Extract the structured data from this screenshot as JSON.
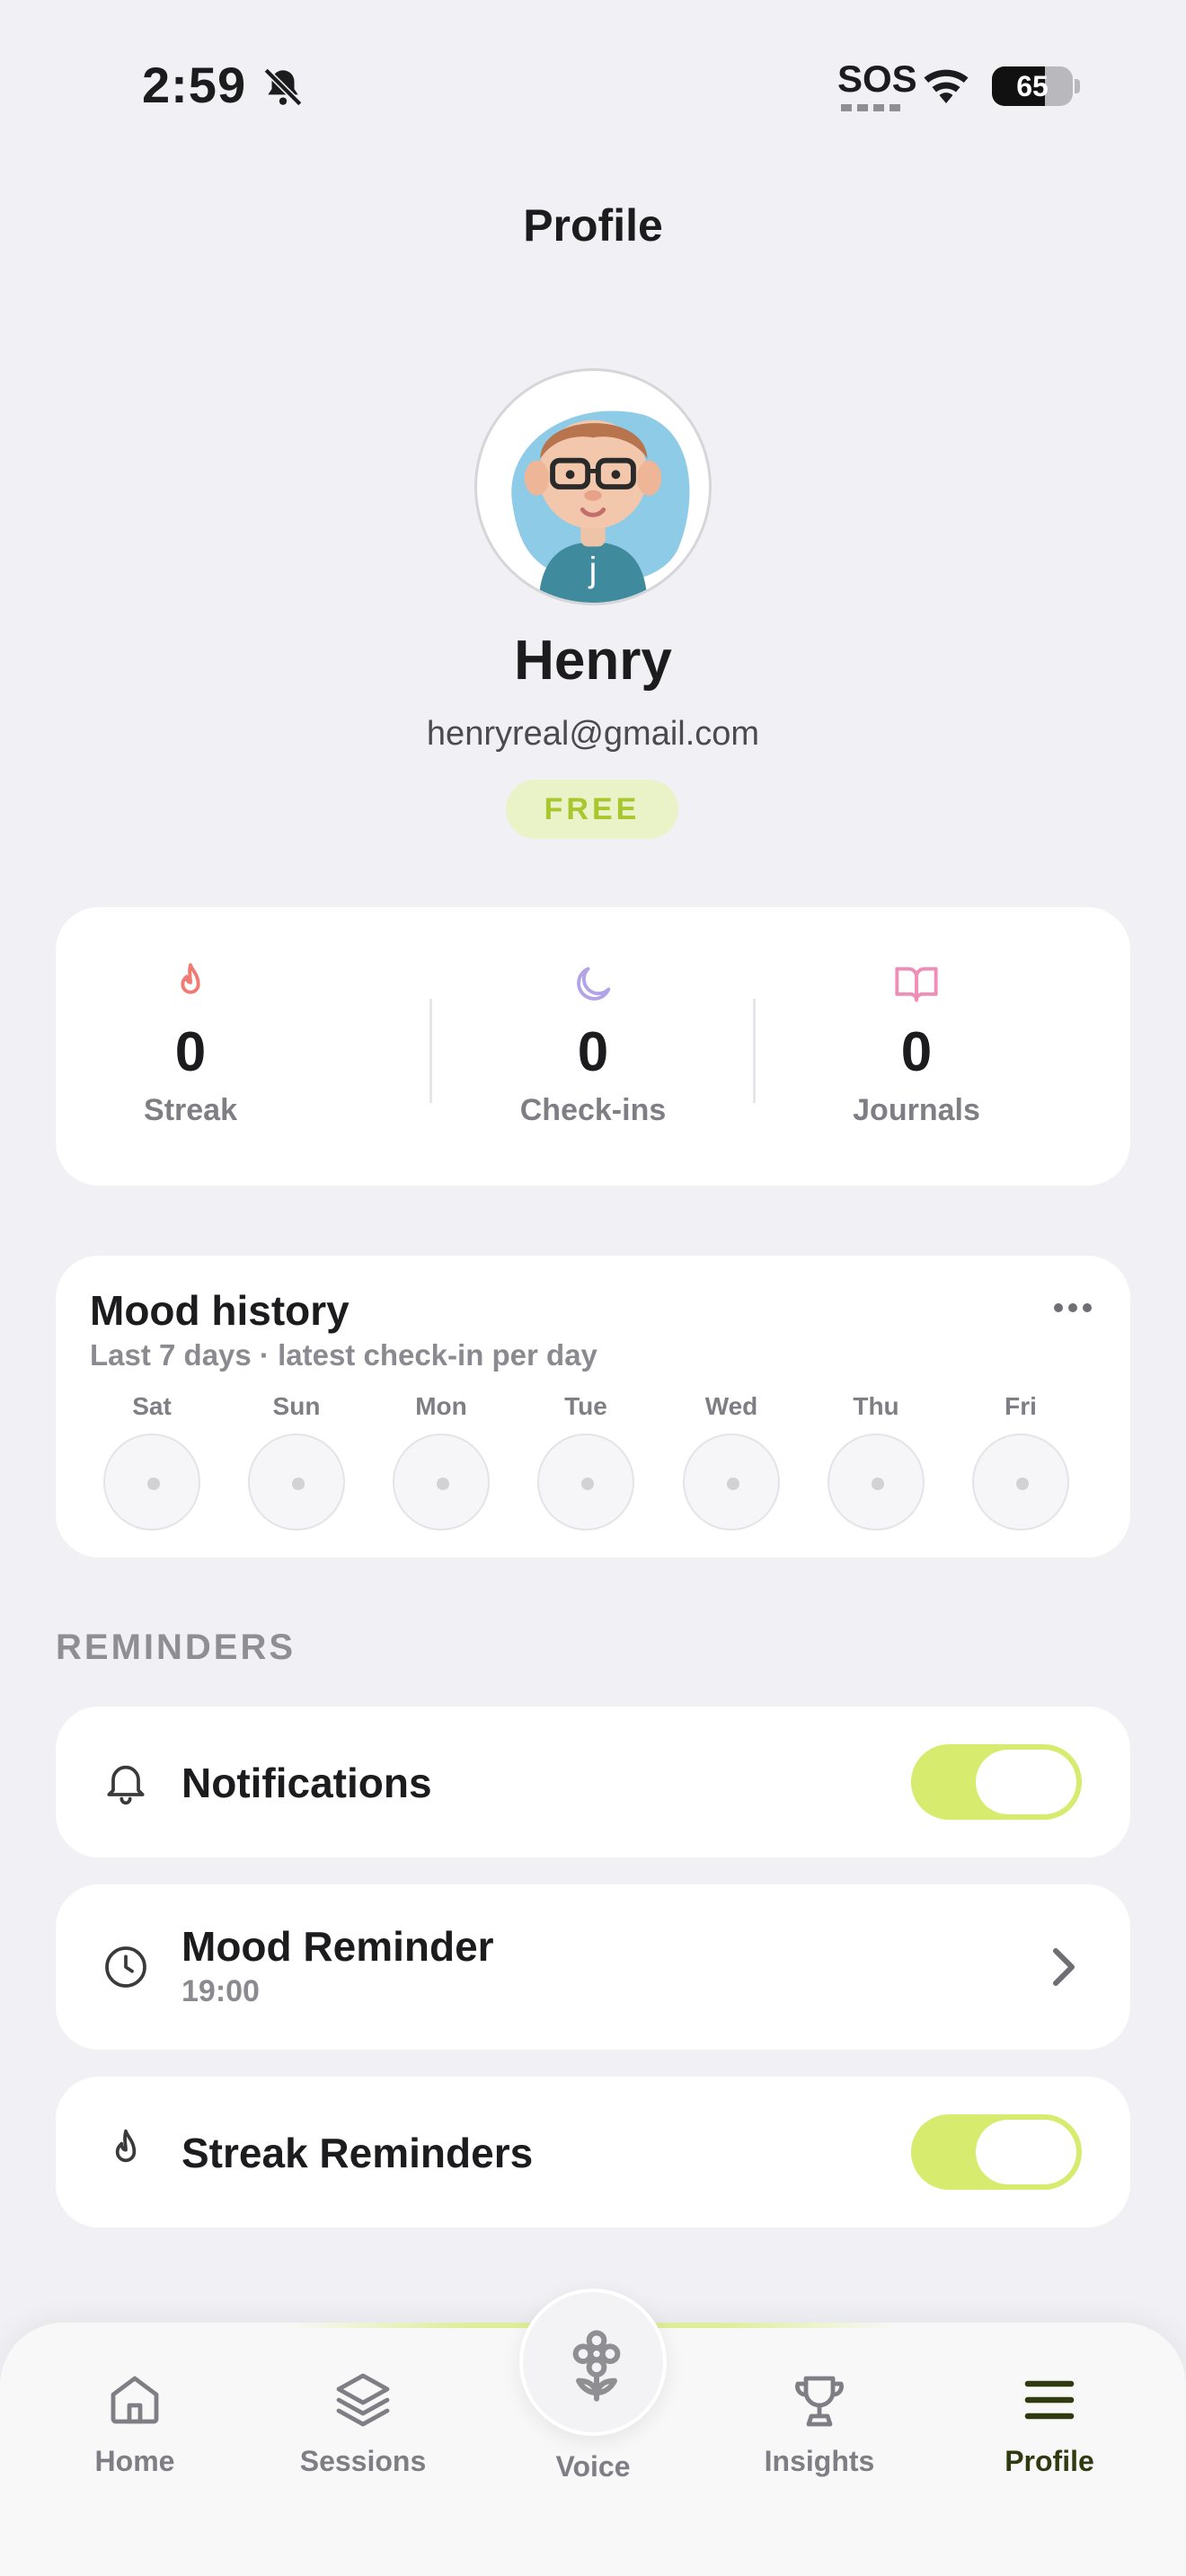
{
  "status_bar": {
    "time": "2:59",
    "sos": "SOS",
    "battery": "65"
  },
  "header": {
    "title": "Profile"
  },
  "user": {
    "name": "Henry",
    "email": "henryreal@gmail.com",
    "plan": "FREE",
    "avatar_shirt_letter": "j"
  },
  "stats": [
    {
      "icon": "flame-icon",
      "value": "0",
      "label": "Streak",
      "color": "#f07b73"
    },
    {
      "icon": "moon-icon",
      "value": "0",
      "label": "Check-ins",
      "color": "#b4a3e6"
    },
    {
      "icon": "book-icon",
      "value": "0",
      "label": "Journals",
      "color": "#ef8fb8"
    }
  ],
  "mood_history": {
    "title": "Mood history",
    "subtitle": "Last 7 days · latest check-in per day",
    "days": [
      "Sat",
      "Sun",
      "Mon",
      "Tue",
      "Wed",
      "Thu",
      "Fri"
    ]
  },
  "reminders": {
    "section_label": "REMINDERS",
    "notifications": {
      "label": "Notifications",
      "enabled": true
    },
    "mood_reminder": {
      "label": "Mood Reminder",
      "time": "19:00"
    },
    "streak_reminders": {
      "label": "Streak Reminders",
      "enabled": true
    }
  },
  "tabbar": {
    "home": "Home",
    "sessions": "Sessions",
    "voice": "Voice",
    "insights": "Insights",
    "profile": "Profile",
    "active": "Profile"
  },
  "colors": {
    "accent_green": "#d7eb6e",
    "badge_text": "#a8c62e",
    "background": "#f1f1f5"
  }
}
